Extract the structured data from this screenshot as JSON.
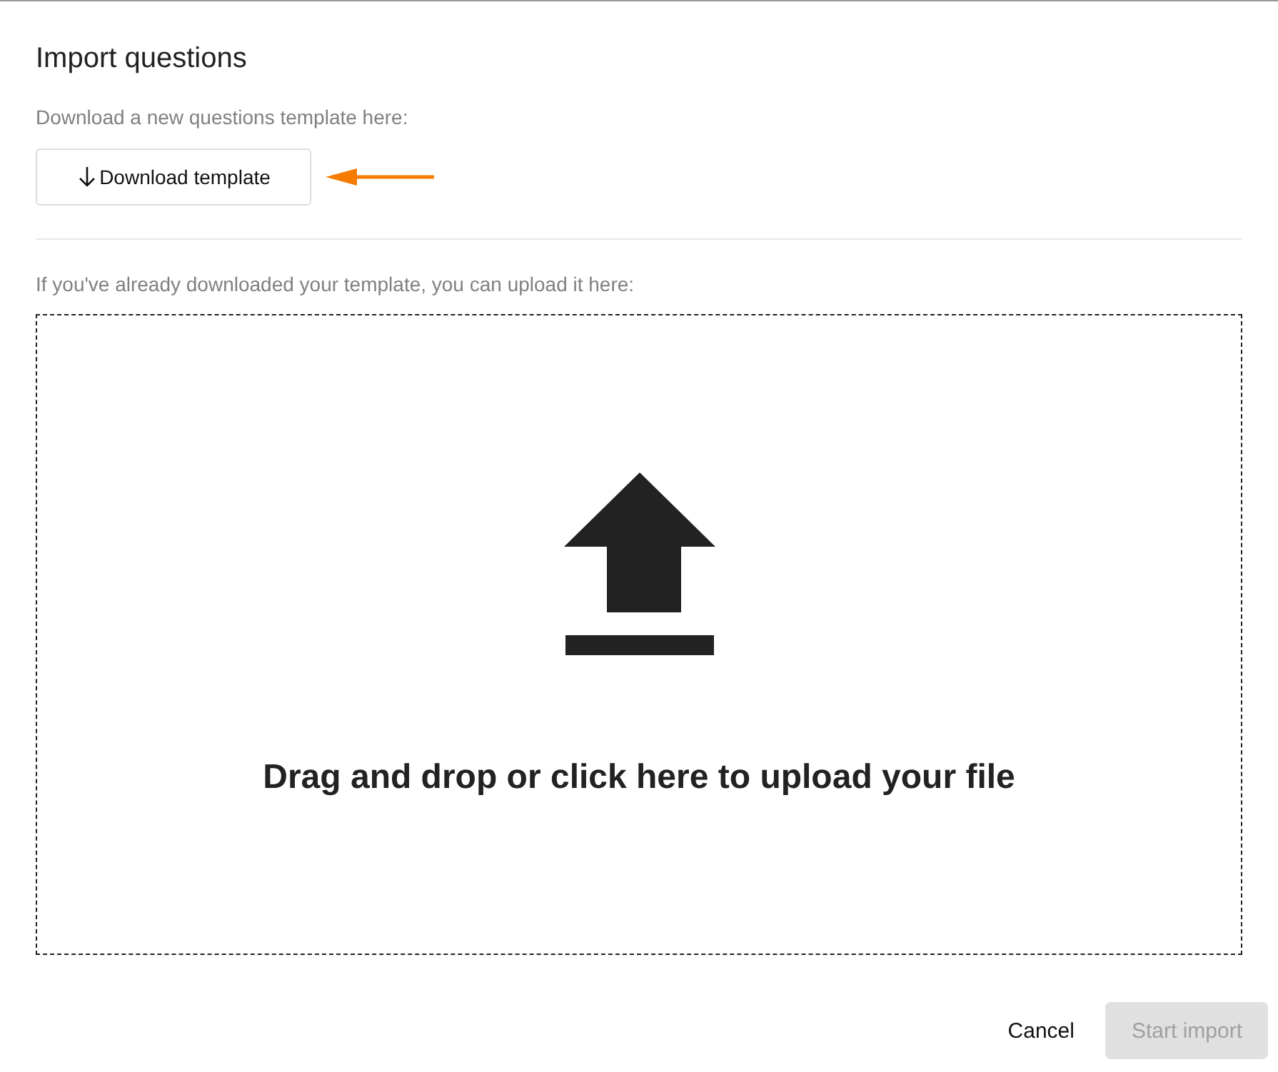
{
  "dialog": {
    "title": "Import questions"
  },
  "download": {
    "hint": "Download a new questions template here:",
    "button": "Download template"
  },
  "upload": {
    "hint": "If you've already downloaded your template, you can upload it here:",
    "dropzone_text": "Drag and drop or click here to upload your file"
  },
  "actions": [
    {
      "label": "Cancel",
      "kind": "text",
      "disabled": false
    },
    {
      "label": "Start import",
      "kind": "filled",
      "disabled": true
    }
  ]
}
